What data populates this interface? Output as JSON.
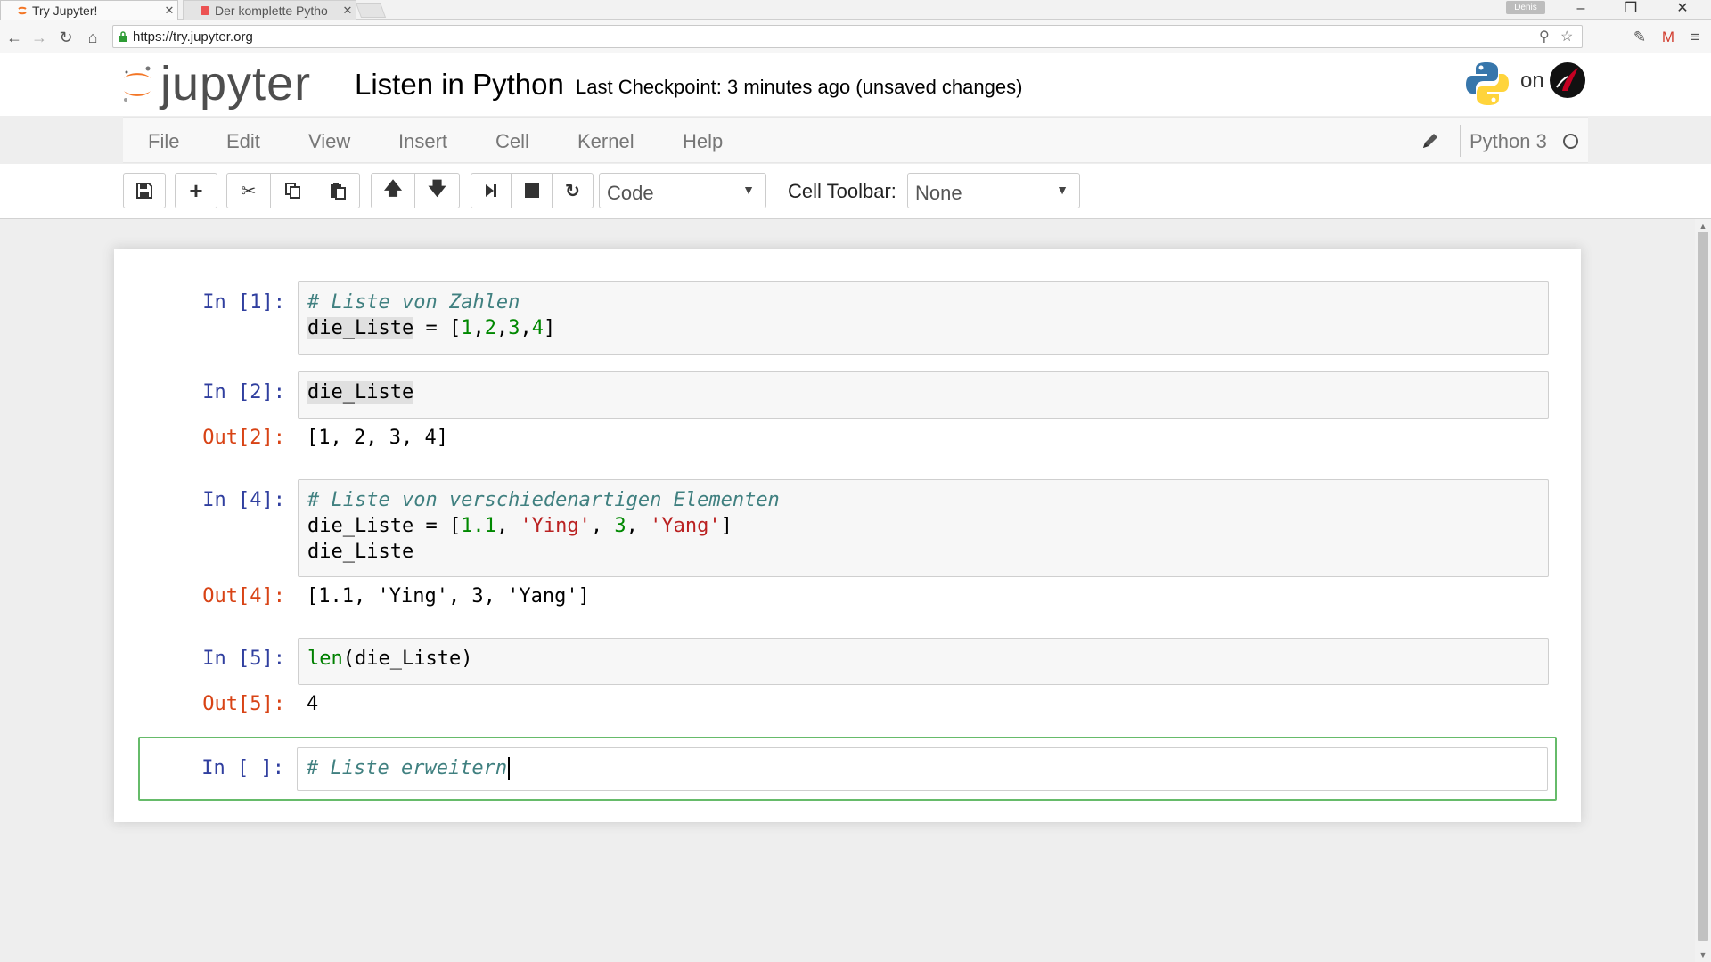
{
  "browser": {
    "tabs": [
      {
        "title": "Try Jupyter!",
        "active": true
      },
      {
        "title": "Der komplette Pytho",
        "active": false
      }
    ],
    "profile_label": "Denis",
    "url": "https://try.jupyter.org"
  },
  "header": {
    "logo_text": "jupyter",
    "notebook_title": "Listen in Python",
    "checkpoint": "Last Checkpoint: 3 minutes ago (unsaved changes)",
    "on_label": "on"
  },
  "menubar": {
    "items": [
      "File",
      "Edit",
      "View",
      "Insert",
      "Cell",
      "Kernel",
      "Help"
    ],
    "kernel_name": "Python 3"
  },
  "toolbar": {
    "cell_type": "Code",
    "cell_toolbar_label": "Cell Toolbar:",
    "cell_toolbar_value": "None"
  },
  "cells": [
    {
      "in_prompt": "In [1]:",
      "line1": "# Liste von Zahlen",
      "line2_var": "die_Liste",
      "line2_eq": " = [",
      "nums": [
        "1",
        "2",
        "3",
        "4"
      ]
    },
    {
      "in_prompt": "In [2]:",
      "code": "die_Liste",
      "out_prompt": "Out[2]:",
      "output": "[1, 2, 3, 4]"
    },
    {
      "in_prompt": "In [4]:",
      "line1": "# Liste von verschiedenartigen Elementen",
      "line2_var": "die_Liste = [",
      "v1": "1.1",
      "s1": "'Ying'",
      "v2": "3",
      "s2": "'Yang'",
      "line3": "die_Liste",
      "out_prompt": "Out[4]:",
      "output": "[1.1, 'Ying', 3, 'Yang']"
    },
    {
      "in_prompt": "In [5]:",
      "builtin": "len",
      "arg": "(die_Liste)",
      "out_prompt": "Out[5]:",
      "output": "4"
    },
    {
      "in_prompt": "In [ ]:",
      "code": "# Liste erweitern"
    }
  ],
  "colors": {
    "in_prompt": "#303f9f",
    "out_prompt": "#d84315",
    "selected_border": "#66bb6a",
    "comment": "#408080",
    "number": "#008800",
    "string": "#ba2121"
  }
}
